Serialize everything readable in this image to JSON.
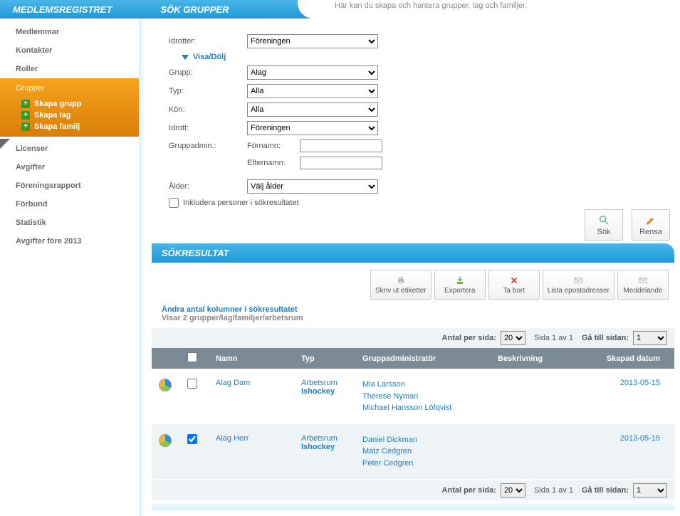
{
  "header": {
    "title": "MEDLEMSREGISTRET",
    "tab": "SÖK GRUPPER",
    "desc": "Här kan du skapa och hantera grupper, lag och familjer."
  },
  "sidebar": {
    "items": [
      {
        "label": "Medlemmar"
      },
      {
        "label": "Kontakter"
      },
      {
        "label": "Roller"
      }
    ],
    "active": {
      "label": "Grupper",
      "subs": [
        {
          "label": "Skapa grupp"
        },
        {
          "label": "Skapa lag"
        },
        {
          "label": "Skapa familj"
        }
      ]
    },
    "items2": [
      {
        "label": "Licenser"
      },
      {
        "label": "Avgifter"
      },
      {
        "label": "Föreningsrapport"
      },
      {
        "label": "Förbund"
      },
      {
        "label": "Statistik"
      },
      {
        "label": "Avgifter före 2013"
      }
    ]
  },
  "filters": {
    "idrotter_label": "Idrotter:",
    "idrotter_value": "Föreningen",
    "visa_dolj": "Visa/Dölj",
    "grupp_label": "Grupp:",
    "grupp_value": "Alag",
    "typ_label": "Typ:",
    "typ_value": "Alla",
    "kon_label": "Kön:",
    "kon_value": "Alla",
    "idrott_label": "Idrott:",
    "idrott_value": "Föreningen",
    "gruppadmin_label": "Gruppadmin.:",
    "fornamn_label": "Förnamn:",
    "efternamn_label": "Efternamn:",
    "alder_label": "Ålder:",
    "alder_value": "Välj ålder",
    "inkludera_label": "Inkludera personer i sökresultatet",
    "sok_btn": "Sök",
    "rensa_btn": "Rensa"
  },
  "results": {
    "title": "SÖKRESULTAT",
    "toolbar": {
      "skriv": "Skriv ut etiketter",
      "exportera": "Exportera",
      "tabort": "Ta bort",
      "lista": "Lista epostadresser",
      "meddelande": "Meddelande"
    },
    "change_cols": "Ändra antal kolumner i sökresultatet",
    "showing": "Visar 2 grupper/lag/familjer/arbetsrum",
    "pager": {
      "antal_label": "Antal per sida:",
      "antal_value": "20",
      "sida": "Sida 1 av 1",
      "ga": "Gå till sidan:",
      "ga_value": "1"
    },
    "columns": {
      "namn": "Namn",
      "typ": "Typ",
      "adm": "Gruppadministratör",
      "besk": "Beskrivning",
      "datum": "Skapad datum"
    },
    "rows": [
      {
        "checked": false,
        "name": "Alag Dam",
        "typ1": "Arbetsrum",
        "typ2": "Ishockey",
        "admins": [
          "Mia Larsson",
          "Therese Nyman",
          "Michael Hansson Löfqvist"
        ],
        "date": "2013-05-15"
      },
      {
        "checked": true,
        "name": "Alag Herr",
        "typ1": "Arbetsrum",
        "typ2": "Ishockey",
        "admins": [
          "Daniel Dickman",
          "Matz Cedgren",
          "Peter Cedgren"
        ],
        "date": "2013-05-15"
      }
    ]
  }
}
